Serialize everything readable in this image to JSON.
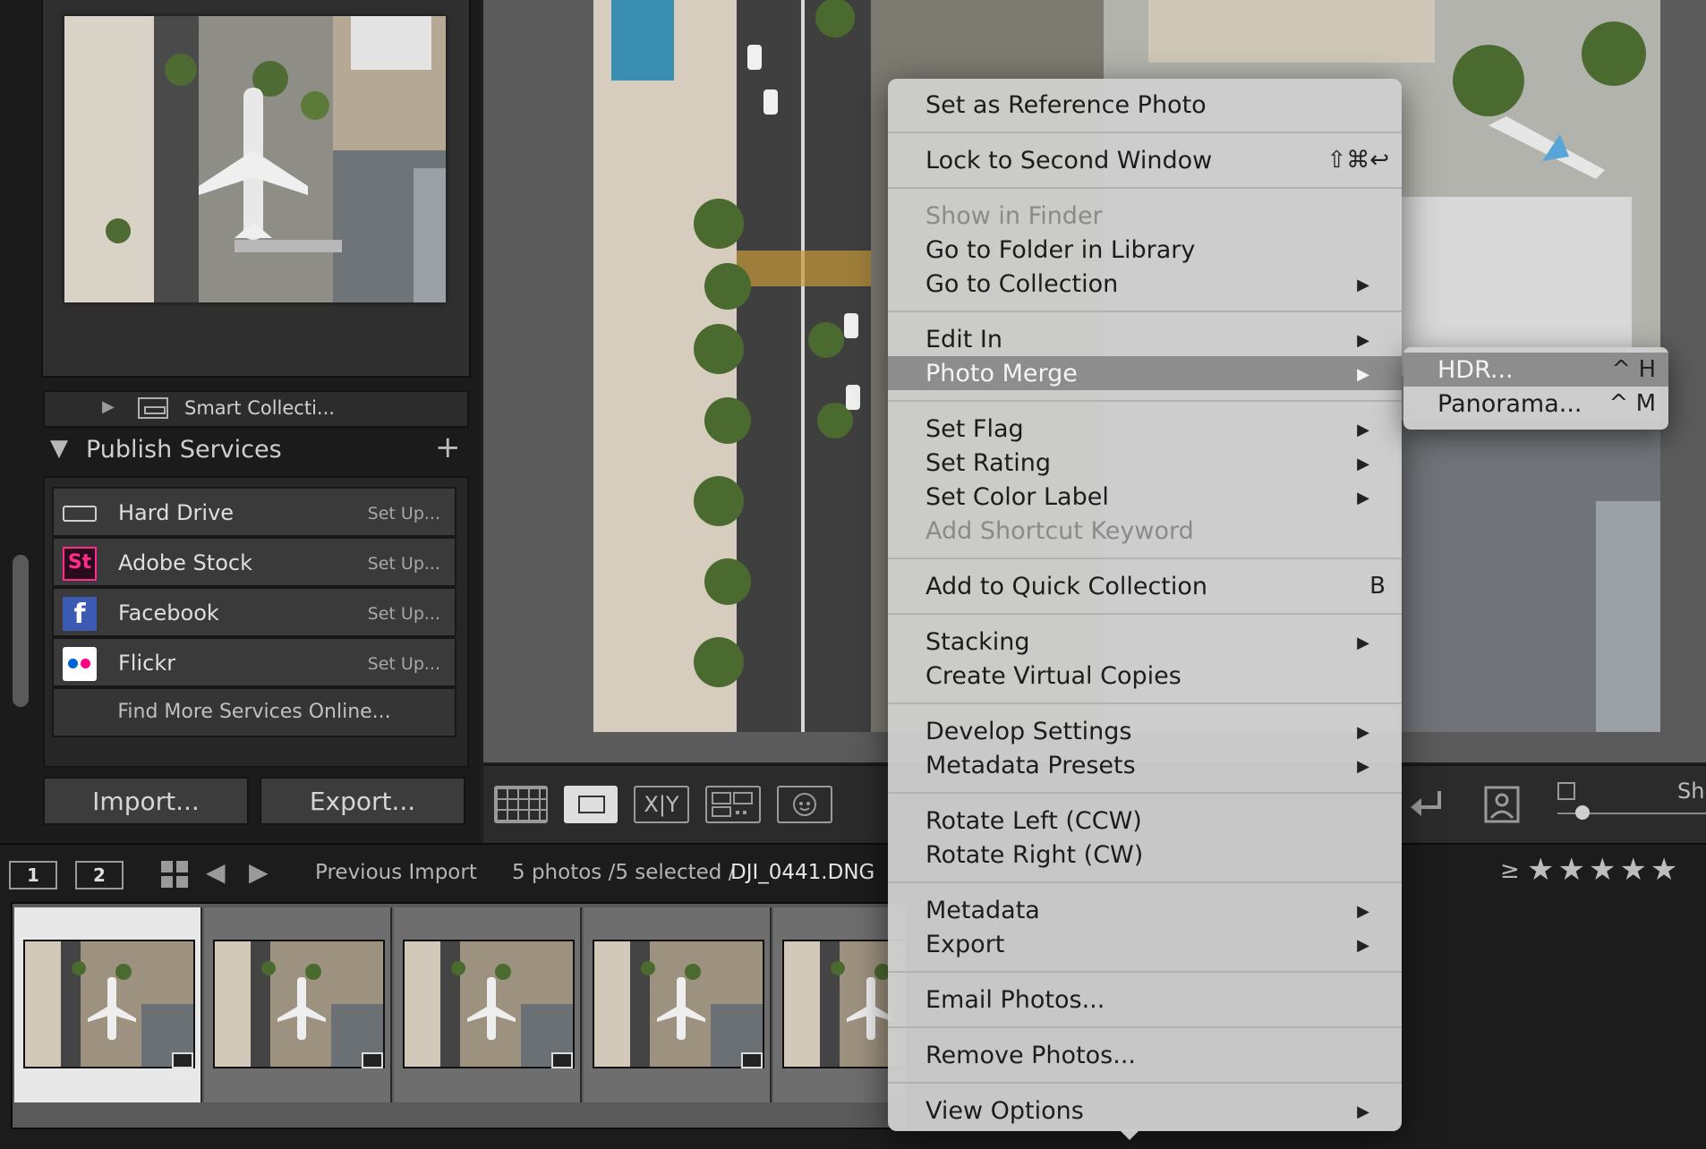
{
  "left_panel": {
    "smart_collection_label": "Smart Collecti...",
    "publish_title": "Publish Services",
    "publish_add": "+",
    "services": [
      {
        "name": "Hard Drive",
        "action": "Set Up...",
        "icon": "hard-drive-icon"
      },
      {
        "name": "Adobe Stock",
        "action": "Set Up...",
        "icon": "adobe-stock-icon",
        "icon_text": "St"
      },
      {
        "name": "Facebook",
        "action": "Set Up...",
        "icon": "facebook-icon",
        "icon_text": "f"
      },
      {
        "name": "Flickr",
        "action": "Set Up...",
        "icon": "flickr-icon"
      }
    ],
    "find_more": "Find More Services Online...",
    "import_label": "Import...",
    "export_label": "Export..."
  },
  "toolbar": {
    "compare_label": "X|Y",
    "show_label": "Sho"
  },
  "filmstrip_bar": {
    "window1": "1",
    "window2": "2",
    "source": "Previous Import",
    "count": "5 photos /5 selected /",
    "filename": "DJI_0441.DNG",
    "rating_prefix": "≥",
    "stars": "★★★★★"
  },
  "context_menu": {
    "set_reference": "Set as Reference Photo",
    "lock_window": "Lock to Second Window",
    "lock_shortcut": "⇧⌘↩",
    "show_finder": "Show in Finder",
    "go_folder": "Go to Folder in Library",
    "go_collection": "Go to Collection",
    "edit_in": "Edit In",
    "photo_merge": "Photo Merge",
    "set_flag": "Set Flag",
    "set_rating": "Set Rating",
    "set_color": "Set Color Label",
    "add_shortcut_kw": "Add Shortcut Keyword",
    "add_quick": "Add to Quick Collection",
    "add_quick_shortcut": "B",
    "stacking": "Stacking",
    "virtual_copies": "Create Virtual Copies",
    "develop_settings": "Develop Settings",
    "metadata_presets": "Metadata Presets",
    "rotate_left": "Rotate Left (CCW)",
    "rotate_right": "Rotate Right (CW)",
    "metadata": "Metadata",
    "export": "Export",
    "email": "Email Photos...",
    "remove": "Remove Photos...",
    "view_options": "View Options",
    "submenu_arrow": "▶"
  },
  "submenu": {
    "hdr": "HDR...",
    "hdr_shortcut": "^ H",
    "panorama": "Panorama...",
    "panorama_shortcut": "^ M"
  },
  "colors": {
    "menu_bg": "#cecece",
    "menu_highlight": "#8d8d8d",
    "panel_bg": "#1b1b1b",
    "loupe_bg": "#5b5b5b"
  }
}
